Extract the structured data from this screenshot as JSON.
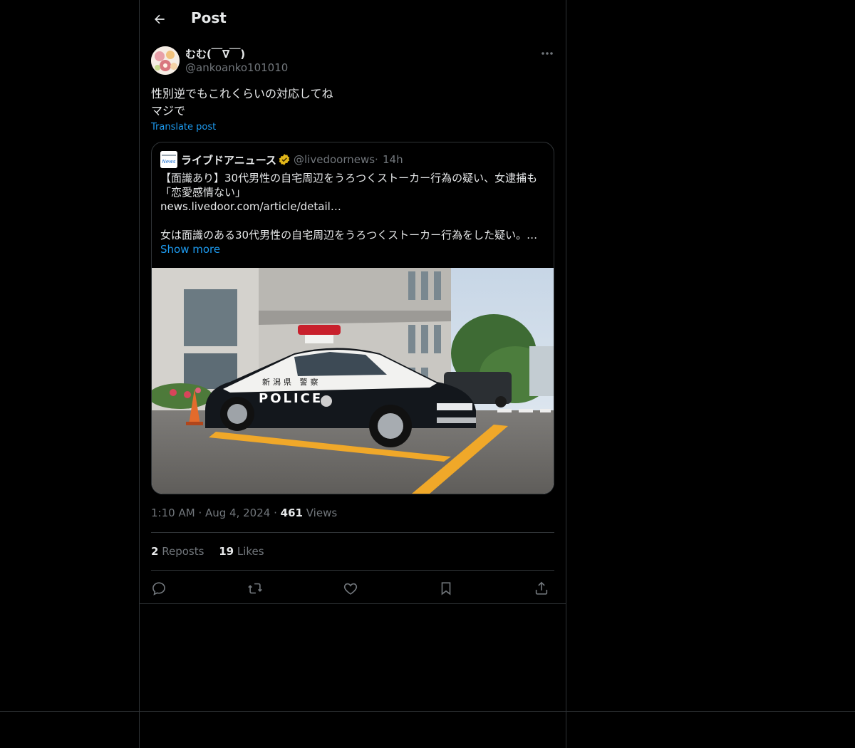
{
  "header": {
    "title": "Post",
    "back_icon": "arrow-left-icon"
  },
  "post": {
    "author": {
      "display_name": "むむ(￣∇￣)",
      "handle": "@ankoanko101010"
    },
    "text_lines": [
      "性別逆でもこれくらいの対応してね",
      "マジで"
    ],
    "translate_label": "Translate post",
    "quoted": {
      "name": "ライブドアニュース",
      "handle": "@livedoornews",
      "separator": "·",
      "time": "14h",
      "verified": true,
      "lines": [
        "【面識あり】30代男性の自宅周辺をうろつくストーカー行為の疑い、女逮捕も",
        "「恋愛感情ない」",
        "news.livedoor.com/article/detail…",
        "女は面識のある30代男性の自宅周辺をうろつくストーカー行為をした疑い。女…"
      ],
      "show_more": "Show more",
      "image_text": {
        "car_lettering": "POLICE",
        "car_kanji": "新潟県 警察"
      }
    },
    "meta": {
      "time": "1:10 AM",
      "separator": "·",
      "date": "Aug 4, 2024",
      "views_count": "461",
      "views_label": "Views"
    },
    "stats": {
      "reposts_count": "2",
      "reposts_label": "Reposts",
      "likes_count": "19",
      "likes_label": "Likes"
    },
    "actions": [
      "reply-icon",
      "repost-icon",
      "like-icon",
      "bookmark-icon",
      "share-icon"
    ]
  },
  "colors": {
    "background": "#000000",
    "text": "#e7e9ea",
    "secondary": "#71767b",
    "accent": "#1d9bf0",
    "border": "#2f3336",
    "verified": "#f4b400"
  }
}
